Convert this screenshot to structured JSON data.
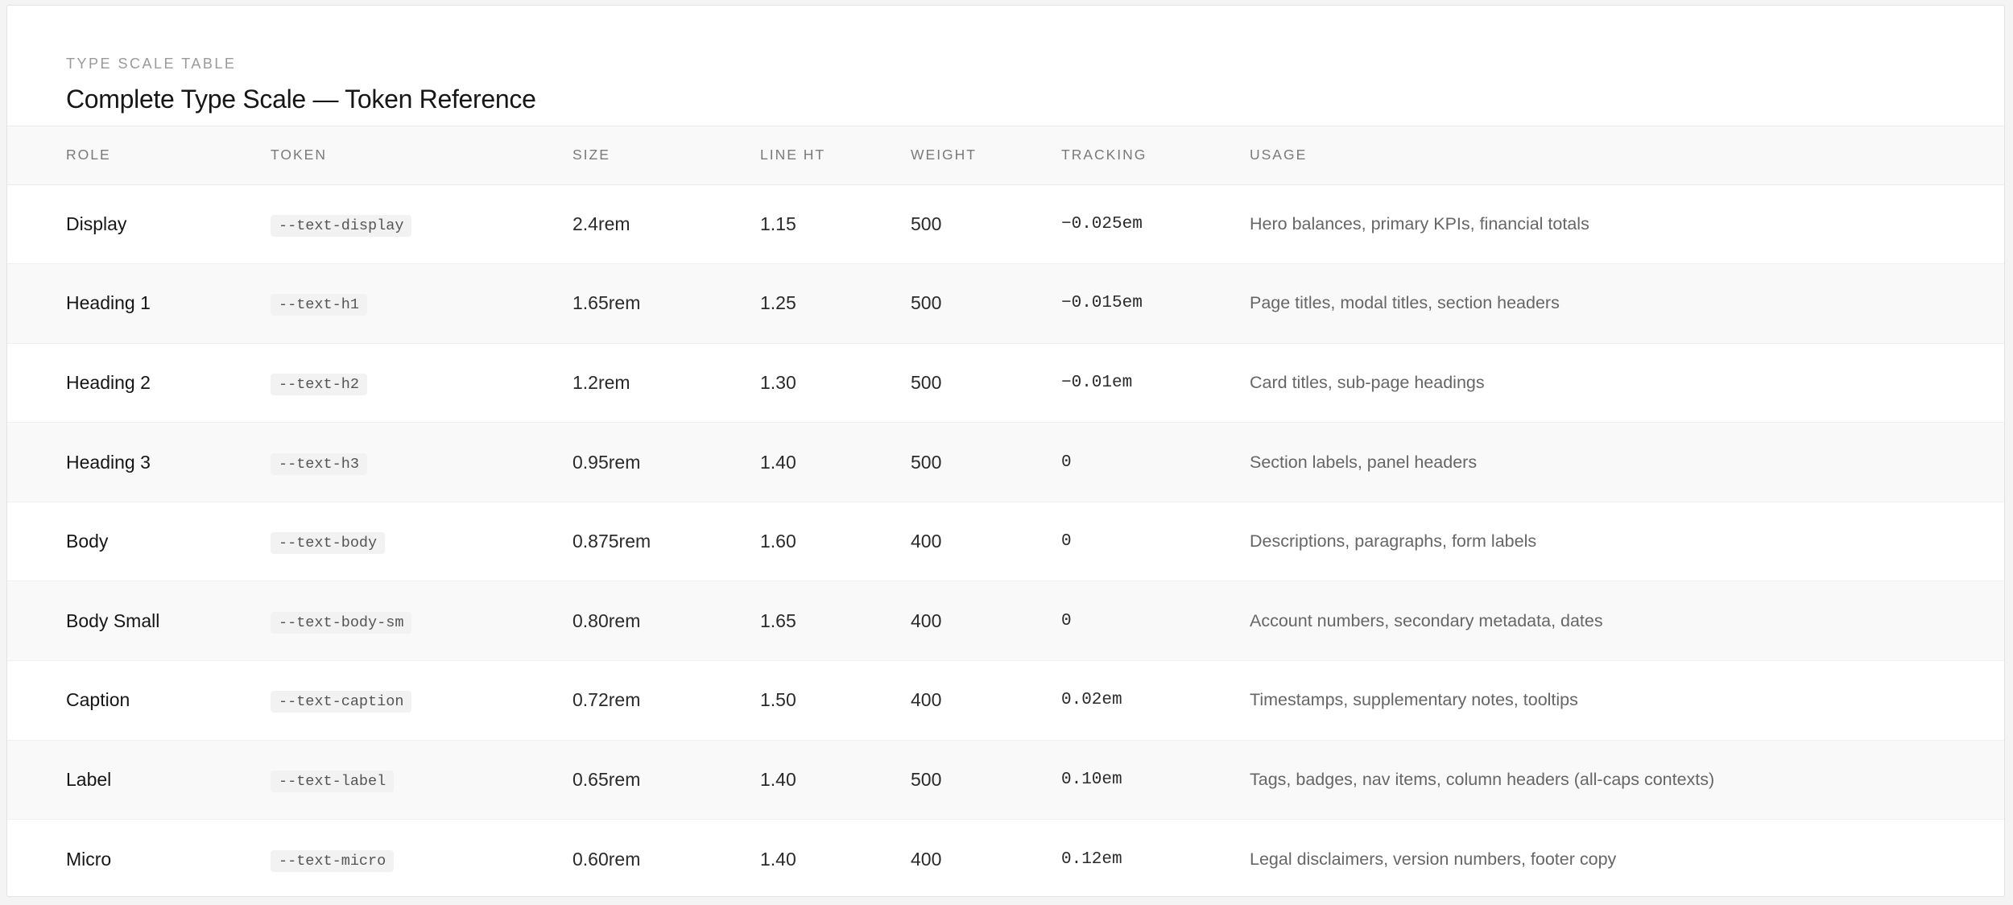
{
  "header": {
    "eyebrow": "TYPE SCALE TABLE",
    "title": "Complete Type Scale — Token Reference"
  },
  "columns": [
    "ROLE",
    "TOKEN",
    "SIZE",
    "LINE HT",
    "WEIGHT",
    "TRACKING",
    "USAGE"
  ],
  "rows": [
    {
      "role": "Display",
      "token": "--text-display",
      "size": "2.4rem",
      "line": "1.15",
      "weight": "500",
      "tracking": "−0.025em",
      "usage": "Hero balances, primary KPIs, financial totals"
    },
    {
      "role": "Heading 1",
      "token": "--text-h1",
      "size": "1.65rem",
      "line": "1.25",
      "weight": "500",
      "tracking": "−0.015em",
      "usage": "Page titles, modal titles, section headers"
    },
    {
      "role": "Heading 2",
      "token": "--text-h2",
      "size": "1.2rem",
      "line": "1.30",
      "weight": "500",
      "tracking": "−0.01em",
      "usage": "Card titles, sub-page headings"
    },
    {
      "role": "Heading 3",
      "token": "--text-h3",
      "size": "0.95rem",
      "line": "1.40",
      "weight": "500",
      "tracking": "0",
      "usage": "Section labels, panel headers"
    },
    {
      "role": "Body",
      "token": "--text-body",
      "size": "0.875rem",
      "line": "1.60",
      "weight": "400",
      "tracking": "0",
      "usage": "Descriptions, paragraphs, form labels"
    },
    {
      "role": "Body Small",
      "token": "--text-body-sm",
      "size": "0.80rem",
      "line": "1.65",
      "weight": "400",
      "tracking": "0",
      "usage": "Account numbers, secondary metadata, dates"
    },
    {
      "role": "Caption",
      "token": "--text-caption",
      "size": "0.72rem",
      "line": "1.50",
      "weight": "400",
      "tracking": "0.02em",
      "usage": "Timestamps, supplementary notes, tooltips"
    },
    {
      "role": "Label",
      "token": "--text-label",
      "size": "0.65rem",
      "line": "1.40",
      "weight": "500",
      "tracking": "0.10em",
      "usage": "Tags, badges, nav items, column headers (all-caps contexts)"
    },
    {
      "role": "Micro",
      "token": "--text-micro",
      "size": "0.60rem",
      "line": "1.40",
      "weight": "400",
      "tracking": "0.12em",
      "usage": "Legal disclaimers, version numbers, footer copy"
    }
  ]
}
